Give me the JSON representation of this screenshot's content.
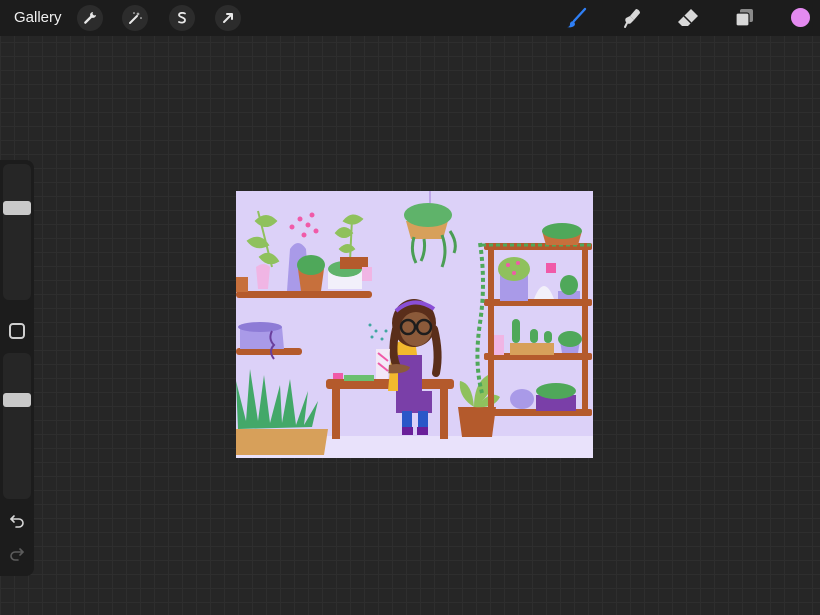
{
  "topbar": {
    "gallery_label": "Gallery",
    "actions": [
      {
        "icon": "wrench-icon",
        "name": "actions"
      },
      {
        "icon": "magic-wand-icon",
        "name": "adjustments"
      },
      {
        "icon": "selection-s-icon",
        "name": "selection"
      },
      {
        "icon": "transform-arrow-icon",
        "name": "transform"
      }
    ],
    "tools": [
      {
        "icon": "brush-icon",
        "name": "brush",
        "active": true
      },
      {
        "icon": "smudge-icon",
        "name": "smudge"
      },
      {
        "icon": "eraser-icon",
        "name": "eraser"
      },
      {
        "icon": "layers-icon",
        "name": "layers"
      }
    ],
    "current_color": "#e48af0"
  },
  "sidebar": {
    "brush_size_level": 0.3,
    "opacity_level": 0.3
  },
  "colors": {
    "accent_blue": "#2f7ff5",
    "canvas_bg": "#dcd1f8"
  }
}
